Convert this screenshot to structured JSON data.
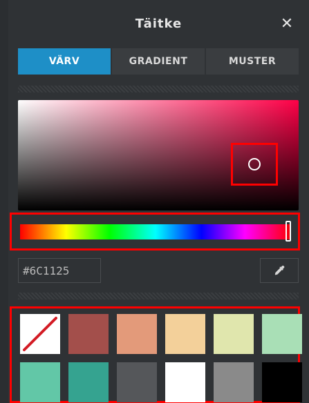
{
  "dialog": {
    "title": "Täitke",
    "close_glyph": "✕"
  },
  "tabs": [
    {
      "label": "VÄRV",
      "active": true
    },
    {
      "label": "GRADIENT",
      "active": false
    },
    {
      "label": "MUSTER",
      "active": false
    }
  ],
  "color": {
    "hex_value": "#6C1125"
  },
  "icons": {
    "close": "close-icon",
    "eyedropper": "eyedropper-icon",
    "no_fill": "no-fill-icon"
  },
  "swatches": {
    "row1": [
      "#ffffff",
      "#a34f4b",
      "#e39a7a",
      "#f3d09a",
      "#e0e6ad",
      "#a9dfb6"
    ],
    "row2": [
      "#62c7a7",
      "#35a390",
      "#55575a",
      "#ffffff",
      "#8a8a8a",
      "#000000"
    ]
  }
}
